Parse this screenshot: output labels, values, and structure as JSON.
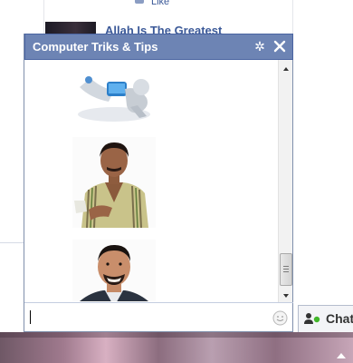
{
  "background": {
    "like_text": "Like",
    "story_title": "Allah Is The Greatest"
  },
  "chat": {
    "title": "Computer Triks & Tips",
    "header_color": "#6d84b4",
    "icons": {
      "settings": "gear-icon",
      "close": "close-icon",
      "emoticon": "smiley-icon"
    },
    "messages": [
      {
        "type": "image",
        "description_icon": "cartoon-image"
      },
      {
        "type": "image",
        "description_icon": "photo-man-striped-shirt"
      },
      {
        "type": "image",
        "description_icon": "photo-man-smiling"
      }
    ],
    "input": {
      "value": "",
      "placeholder": ""
    }
  },
  "chat_tab": {
    "label": "Chat",
    "status_color": "#42b72a"
  }
}
